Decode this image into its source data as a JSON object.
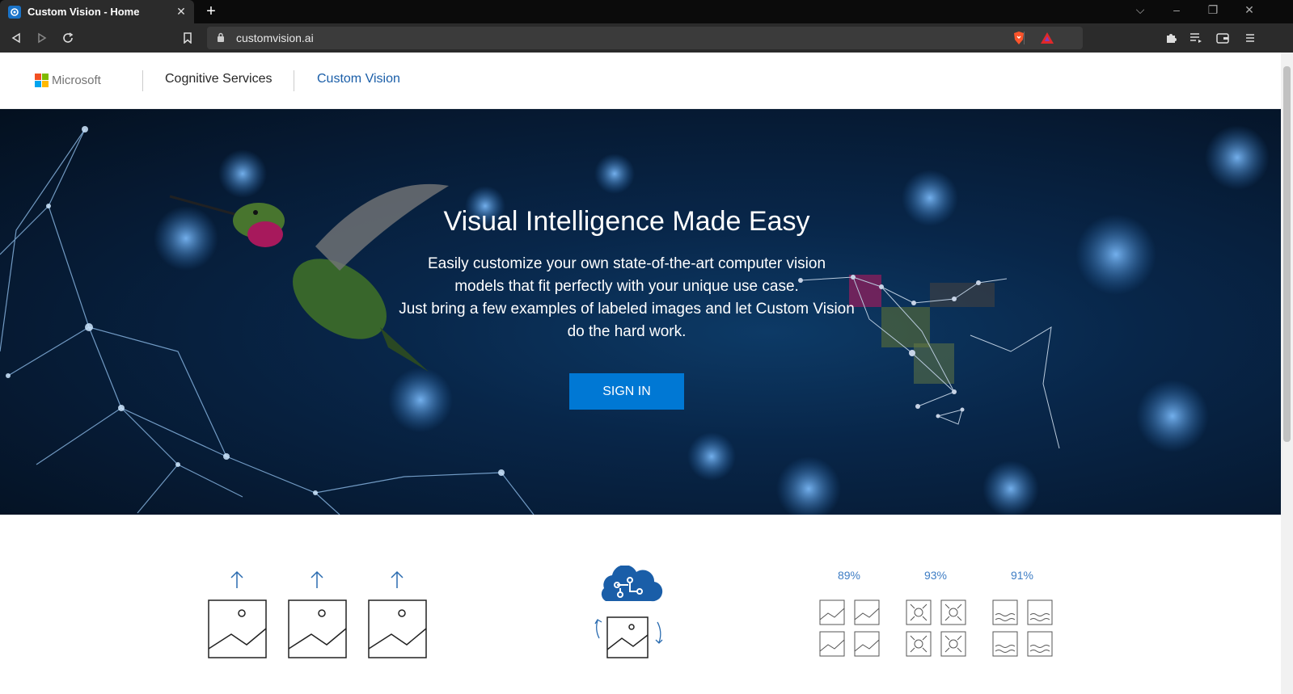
{
  "browser": {
    "tab_title": "Custom Vision - Home",
    "url": "customvision.ai"
  },
  "header": {
    "brand": "Microsoft",
    "nav": [
      {
        "label": "Cognitive Services"
      },
      {
        "label": "Custom Vision"
      }
    ]
  },
  "hero": {
    "title": "Visual Intelligence Made Easy",
    "desc_line1": "Easily customize your own state-of-the-art computer vision",
    "desc_line2": "models that fit perfectly with your unique use case.",
    "desc_line3": "Just bring a few examples of labeled images and let Custom Vision",
    "desc_line4": "do the hard work.",
    "signin_label": "SIGN IN"
  },
  "steps": {
    "percentages": [
      "89%",
      "93%",
      "91%"
    ]
  },
  "colors": {
    "accent": "#0078d4",
    "link": "#1a5ea8",
    "hero_bg": "#082649"
  }
}
